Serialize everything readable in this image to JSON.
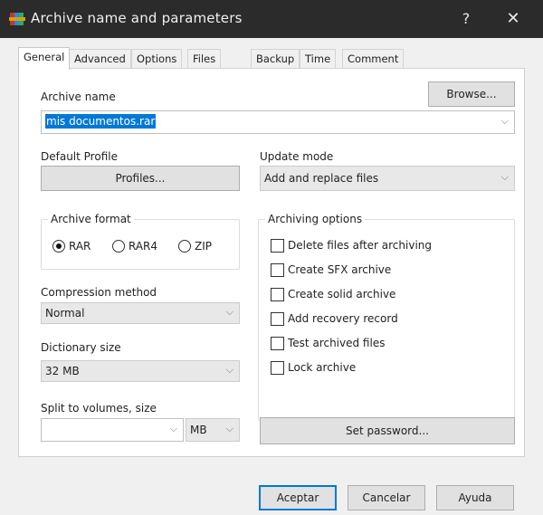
{
  "window": {
    "title": "Archive name and parameters",
    "help_glyph": "?",
    "close_glyph": "✕"
  },
  "tabs": [
    {
      "label": "General",
      "active": true
    },
    {
      "label": "Advanced",
      "active": false
    },
    {
      "label": "Options",
      "active": false
    },
    {
      "label": "Files",
      "active": false
    },
    {
      "label": "Backup",
      "active": false
    },
    {
      "label": "Time",
      "active": false
    },
    {
      "label": "Comment",
      "active": false
    }
  ],
  "general": {
    "archive_name_label": "Archive name",
    "browse_label": "Browse...",
    "archive_name_value": "mis documentos.rar",
    "default_profile_label": "Default Profile",
    "profiles_label": "Profiles...",
    "update_mode_label": "Update mode",
    "update_mode_value": "Add and replace files",
    "archive_format": {
      "caption": "Archive format",
      "options": [
        "RAR",
        "RAR4",
        "ZIP"
      ],
      "selected": "RAR"
    },
    "compression_method_label": "Compression method",
    "compression_method_value": "Normal",
    "dictionary_size_label": "Dictionary size",
    "dictionary_size_value": "32 MB",
    "split_label": "Split to volumes, size",
    "split_value": "",
    "split_unit": "MB",
    "archiving_options": {
      "caption": "Archiving options",
      "items": [
        {
          "label": "Delete files after archiving",
          "checked": false
        },
        {
          "label": "Create SFX archive",
          "checked": false
        },
        {
          "label": "Create solid archive",
          "checked": false
        },
        {
          "label": "Add recovery record",
          "checked": false
        },
        {
          "label": "Test archived files",
          "checked": false
        },
        {
          "label": "Lock archive",
          "checked": false
        }
      ]
    },
    "set_password_label": "Set password..."
  },
  "footer": {
    "ok_label": "Aceptar",
    "cancel_label": "Cancelar",
    "help_label": "Ayuda"
  },
  "icons": {
    "app": "winrar-books-icon",
    "dropdown": "chevron-down-icon"
  }
}
